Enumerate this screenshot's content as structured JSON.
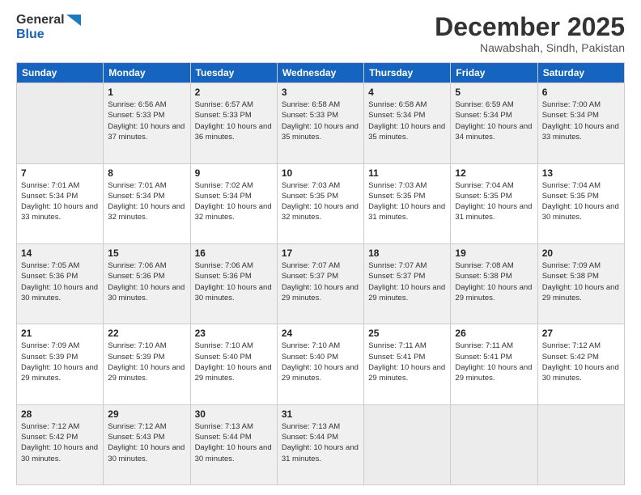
{
  "logo": {
    "line1": "General",
    "line2": "Blue"
  },
  "title": "December 2025",
  "subtitle": "Nawabshah, Sindh, Pakistan",
  "weekdays": [
    "Sunday",
    "Monday",
    "Tuesday",
    "Wednesday",
    "Thursday",
    "Friday",
    "Saturday"
  ],
  "weeks": [
    [
      {
        "day": "",
        "empty": true
      },
      {
        "day": "1",
        "sunrise": "6:56 AM",
        "sunset": "5:33 PM",
        "daylight": "10 hours and 37 minutes."
      },
      {
        "day": "2",
        "sunrise": "6:57 AM",
        "sunset": "5:33 PM",
        "daylight": "10 hours and 36 minutes."
      },
      {
        "day": "3",
        "sunrise": "6:58 AM",
        "sunset": "5:33 PM",
        "daylight": "10 hours and 35 minutes."
      },
      {
        "day": "4",
        "sunrise": "6:58 AM",
        "sunset": "5:34 PM",
        "daylight": "10 hours and 35 minutes."
      },
      {
        "day": "5",
        "sunrise": "6:59 AM",
        "sunset": "5:34 PM",
        "daylight": "10 hours and 34 minutes."
      },
      {
        "day": "6",
        "sunrise": "7:00 AM",
        "sunset": "5:34 PM",
        "daylight": "10 hours and 33 minutes."
      }
    ],
    [
      {
        "day": "7",
        "sunrise": "7:01 AM",
        "sunset": "5:34 PM",
        "daylight": "10 hours and 33 minutes."
      },
      {
        "day": "8",
        "sunrise": "7:01 AM",
        "sunset": "5:34 PM",
        "daylight": "10 hours and 32 minutes."
      },
      {
        "day": "9",
        "sunrise": "7:02 AM",
        "sunset": "5:34 PM",
        "daylight": "10 hours and 32 minutes."
      },
      {
        "day": "10",
        "sunrise": "7:03 AM",
        "sunset": "5:35 PM",
        "daylight": "10 hours and 32 minutes."
      },
      {
        "day": "11",
        "sunrise": "7:03 AM",
        "sunset": "5:35 PM",
        "daylight": "10 hours and 31 minutes."
      },
      {
        "day": "12",
        "sunrise": "7:04 AM",
        "sunset": "5:35 PM",
        "daylight": "10 hours and 31 minutes."
      },
      {
        "day": "13",
        "sunrise": "7:04 AM",
        "sunset": "5:35 PM",
        "daylight": "10 hours and 30 minutes."
      }
    ],
    [
      {
        "day": "14",
        "sunrise": "7:05 AM",
        "sunset": "5:36 PM",
        "daylight": "10 hours and 30 minutes."
      },
      {
        "day": "15",
        "sunrise": "7:06 AM",
        "sunset": "5:36 PM",
        "daylight": "10 hours and 30 minutes."
      },
      {
        "day": "16",
        "sunrise": "7:06 AM",
        "sunset": "5:36 PM",
        "daylight": "10 hours and 30 minutes."
      },
      {
        "day": "17",
        "sunrise": "7:07 AM",
        "sunset": "5:37 PM",
        "daylight": "10 hours and 29 minutes."
      },
      {
        "day": "18",
        "sunrise": "7:07 AM",
        "sunset": "5:37 PM",
        "daylight": "10 hours and 29 minutes."
      },
      {
        "day": "19",
        "sunrise": "7:08 AM",
        "sunset": "5:38 PM",
        "daylight": "10 hours and 29 minutes."
      },
      {
        "day": "20",
        "sunrise": "7:09 AM",
        "sunset": "5:38 PM",
        "daylight": "10 hours and 29 minutes."
      }
    ],
    [
      {
        "day": "21",
        "sunrise": "7:09 AM",
        "sunset": "5:39 PM",
        "daylight": "10 hours and 29 minutes."
      },
      {
        "day": "22",
        "sunrise": "7:10 AM",
        "sunset": "5:39 PM",
        "daylight": "10 hours and 29 minutes."
      },
      {
        "day": "23",
        "sunrise": "7:10 AM",
        "sunset": "5:40 PM",
        "daylight": "10 hours and 29 minutes."
      },
      {
        "day": "24",
        "sunrise": "7:10 AM",
        "sunset": "5:40 PM",
        "daylight": "10 hours and 29 minutes."
      },
      {
        "day": "25",
        "sunrise": "7:11 AM",
        "sunset": "5:41 PM",
        "daylight": "10 hours and 29 minutes."
      },
      {
        "day": "26",
        "sunrise": "7:11 AM",
        "sunset": "5:41 PM",
        "daylight": "10 hours and 29 minutes."
      },
      {
        "day": "27",
        "sunrise": "7:12 AM",
        "sunset": "5:42 PM",
        "daylight": "10 hours and 30 minutes."
      }
    ],
    [
      {
        "day": "28",
        "sunrise": "7:12 AM",
        "sunset": "5:42 PM",
        "daylight": "10 hours and 30 minutes."
      },
      {
        "day": "29",
        "sunrise": "7:12 AM",
        "sunset": "5:43 PM",
        "daylight": "10 hours and 30 minutes."
      },
      {
        "day": "30",
        "sunrise": "7:13 AM",
        "sunset": "5:44 PM",
        "daylight": "10 hours and 30 minutes."
      },
      {
        "day": "31",
        "sunrise": "7:13 AM",
        "sunset": "5:44 PM",
        "daylight": "10 hours and 31 minutes."
      },
      {
        "day": "",
        "empty": true
      },
      {
        "day": "",
        "empty": true
      },
      {
        "day": "",
        "empty": true
      }
    ]
  ]
}
